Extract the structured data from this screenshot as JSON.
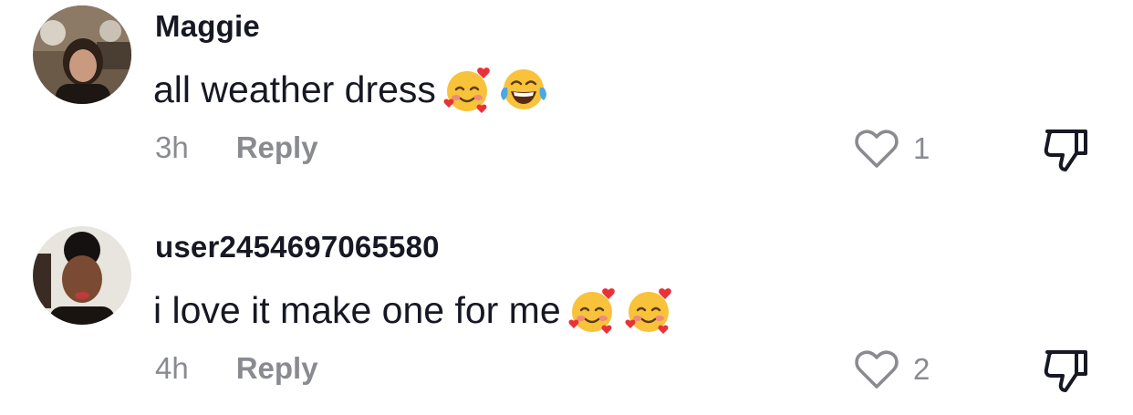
{
  "comments": [
    {
      "username": "Maggie",
      "text": "all weather dress",
      "emojis": [
        "smiling-face-with-hearts-icon",
        "face-with-tears-of-joy-icon"
      ],
      "time": "3h",
      "reply_label": "Reply",
      "like_count": "1"
    },
    {
      "username": "user2454697065580",
      "text": "i love it make one for me",
      "emojis": [
        "smiling-face-with-hearts-icon",
        "smiling-face-with-hearts-icon"
      ],
      "time": "4h",
      "reply_label": "Reply",
      "like_count": "2"
    }
  ],
  "colors": {
    "text_primary": "#161823",
    "text_secondary": "#8a8b91",
    "background": "#ffffff"
  }
}
